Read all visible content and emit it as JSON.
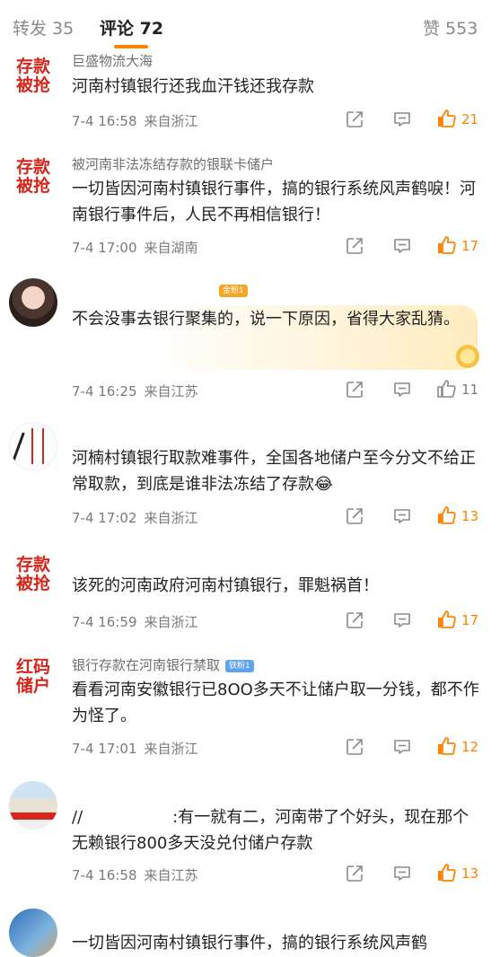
{
  "tabs": {
    "repost": "转发 35",
    "comments": "评论 72",
    "likes": "赞 553"
  },
  "comments": [
    {
      "avatar_line1": "存款",
      "avatar_line2": "被抢",
      "username": "巨盛物流大海",
      "text": "河南村镇银行还我血汗钱还我存款",
      "time": "7-4 16:58",
      "location": "来自浙江",
      "likes": "21"
    },
    {
      "avatar_line1": "存款",
      "avatar_line2": "被抢",
      "username": "被河南非法冻结存款的银联卡储户",
      "text": "一切皆因河南村镇银行事件，搞的银行系统风声鹤唳！河南银行事件后，人民不再相信银行！",
      "time": "7-4 17:00",
      "location": "来自湖南",
      "likes": "17"
    },
    {
      "badge": "金粉1",
      "text": "不会没事去银行聚集的，说一下原因，省得大家乱猜。",
      "time": "7-4 16:25",
      "location": "来自江苏",
      "likes": "11"
    },
    {
      "text": "河楠村镇银行取款难事件，全国各地储户至今分文不给正常取款，到底是谁非法冻结了存款😂",
      "time": "7-4 17:02",
      "location": "来自浙江",
      "likes": "13"
    },
    {
      "avatar_line1": "存款",
      "avatar_line2": "被抢",
      "text": "该死的河南政府河南村镇银行，罪魁祸首！",
      "time": "7-4 16:59",
      "location": "来自浙江",
      "likes": "17"
    },
    {
      "avatar_line1": "红码",
      "avatar_line2": "储户",
      "username": "银行存款在河南银行禁取",
      "badge": "铁粉1",
      "text": "看看河南安徽银行已8OO多天不让储户取一分钱，都不作为怪了。",
      "time": "7-4 17:01",
      "location": "来自浙江",
      "likes": "12"
    },
    {
      "text_prefix": "//",
      "text": ":有一就有二，河南带了个好头，现在那个无赖银行800多天没兑付储户存款",
      "time": "7-4 16:58",
      "location": "来自江苏",
      "likes": "13"
    },
    {
      "text": "一切皆因河南村镇银行事件，搞的银行系统风声鹤"
    }
  ],
  "colors": {
    "accent": "#ff8200",
    "avatar_red": "#d4261b"
  },
  "icons": {
    "share": "share-icon",
    "comment": "comment-icon",
    "like": "thumbs-up-icon"
  }
}
